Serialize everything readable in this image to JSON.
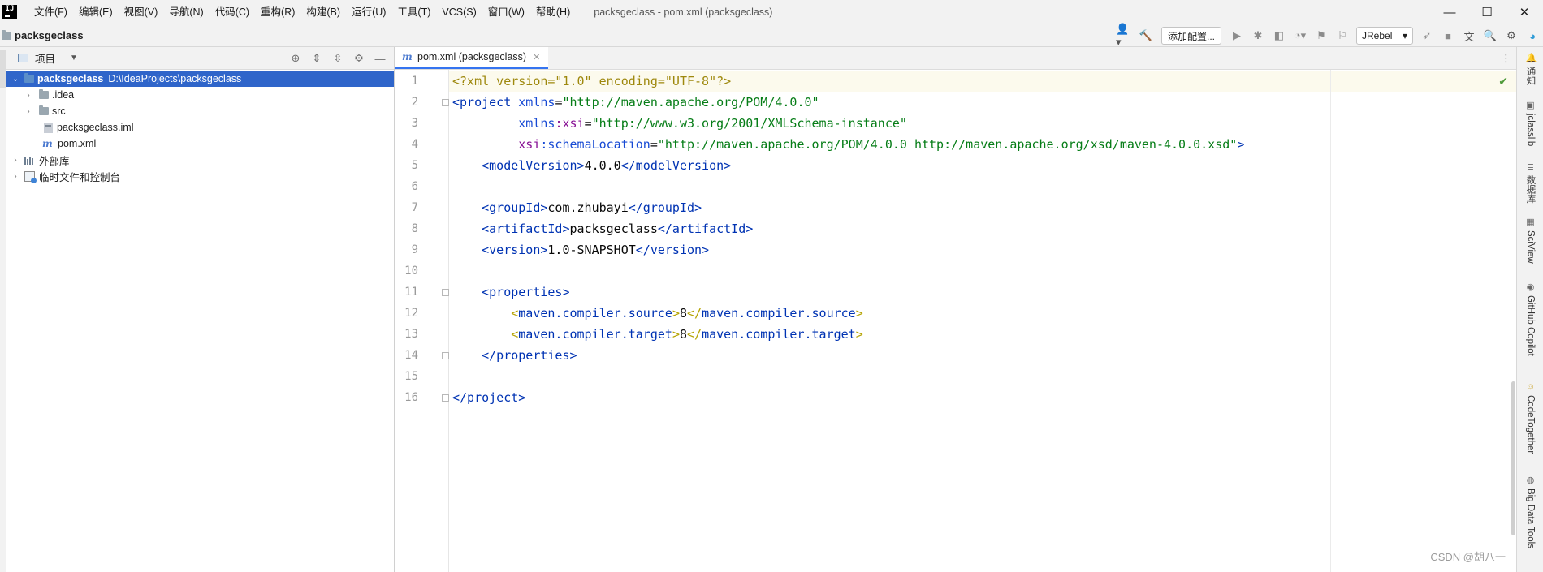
{
  "menu": {
    "app_logo": "IJ",
    "items": [
      "文件(F)",
      "编辑(E)",
      "视图(V)",
      "导航(N)",
      "代码(C)",
      "重构(R)",
      "构建(B)",
      "运行(U)",
      "工具(T)",
      "VCS(S)",
      "窗口(W)",
      "帮助(H)"
    ],
    "window_title": "packsgeclass - pom.xml (packsgeclass)"
  },
  "window_controls": {
    "minimize": "—",
    "maximize": "☐",
    "close": "✕"
  },
  "navbar": {
    "project_name": "packsgeclass",
    "add_config_label": "添加配置...",
    "jrebel_label": "JRebel"
  },
  "project_panel": {
    "title": "项目",
    "tree": [
      {
        "label": "packsgeclass",
        "path": "D:\\IdeaProjects\\packsgeclass"
      },
      {
        "label": ".idea"
      },
      {
        "label": "src"
      },
      {
        "label": "packsgeclass.iml"
      },
      {
        "label": "pom.xml"
      },
      {
        "label": "外部库"
      },
      {
        "label": "临时文件和控制台"
      }
    ]
  },
  "editor": {
    "tab_label": "pom.xml (packsgeclass)",
    "line_numbers": [
      "1",
      "2",
      "3",
      "4",
      "5",
      "6",
      "7",
      "8",
      "9",
      "10",
      "11",
      "12",
      "13",
      "14",
      "15",
      "16"
    ],
    "code": {
      "l1_decl": "<?xml version=\"1.0\" encoding=\"UTF-8\"?>",
      "l2_open": "<project",
      "l2_attr": "xmlns",
      "l2_val": "\"http://maven.apache.org/POM/4.0.0\"",
      "l3_ns": "xmlns",
      "l3_attr": ":xsi",
      "l3_val": "\"http://www.w3.org/2001/XMLSchema-instance\"",
      "l4_ns": "xsi",
      "l4_attr": ":schemaLocation",
      "l4_val": "\"http://maven.apache.org/POM/4.0.0 http://maven.apache.org/xsd/maven-4.0.0.xsd\"",
      "l4_close": ">",
      "l5_open": "<modelVersion>",
      "l5_text": "4.0.0",
      "l5_close": "</modelVersion>",
      "l7_open": "<groupId>",
      "l7_text": "com.zhubayi",
      "l7_close": "</groupId>",
      "l8_open": "<artifactId>",
      "l8_text": "packsgeclass",
      "l8_close": "</artifactId>",
      "l9_open": "<version>",
      "l9_text": "1.0-SNAPSHOT",
      "l9_close": "</version>",
      "l11_open": "<properties>",
      "l12_lt": "<",
      "l12_tag": "maven.compiler.source",
      "l12_gt": ">",
      "l12_text": "8",
      "l12_clt": "</",
      "l12_ctag": "maven.compiler.source",
      "l12_cgt": ">",
      "l13_lt": "<",
      "l13_tag": "maven.compiler.target",
      "l13_gt": ">",
      "l13_text": "8",
      "l13_clt": "</",
      "l13_ctag": "maven.compiler.target",
      "l13_cgt": ">",
      "l14_close": "</properties>",
      "l16_close": "</project>"
    }
  },
  "right_stripe": [
    {
      "label": "通知",
      "icon": "bell-icon"
    },
    {
      "label": "jclasslib",
      "icon": "jclasslib-icon"
    },
    {
      "label": "数据库",
      "icon": "database-icon"
    },
    {
      "label": "SciView",
      "icon": "sciview-icon"
    },
    {
      "label": "GitHub Copilot",
      "icon": "copilot-icon"
    },
    {
      "label": "CodeTogether",
      "icon": "codetogether-icon"
    },
    {
      "label": "Big Data Tools",
      "icon": "bigdata-icon"
    }
  ],
  "watermark": "CSDN @胡八一",
  "colors": {
    "selection": "#2f65ca",
    "tab_underline": "#3574f0",
    "xml_tag": "#0033b3",
    "xml_string": "#067d17",
    "xml_namespace": "#871094"
  }
}
